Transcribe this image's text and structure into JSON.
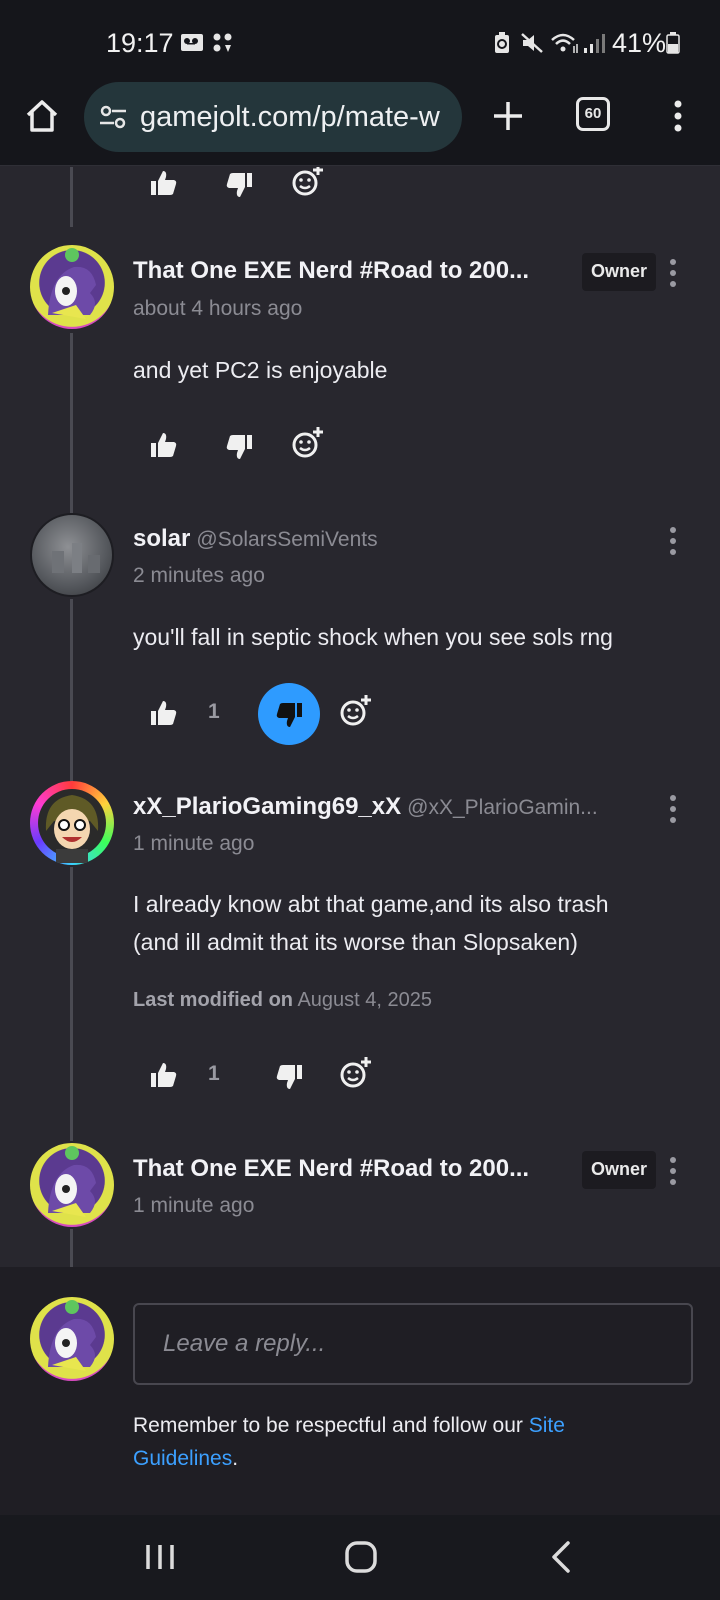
{
  "status_bar": {
    "time": "19:17",
    "battery_pct": "41%",
    "icons": [
      "voicemail-icon",
      "dots-icon",
      "battery-saver-icon",
      "mute-icon",
      "wifi-icon",
      "signal-icon",
      "battery-icon"
    ]
  },
  "browser": {
    "url": "gamejolt.com/p/mate-w",
    "tab_count": "60",
    "icons": [
      "home-icon",
      "site-settings-icon",
      "new-tab-icon",
      "tabs-icon",
      "menu-icon"
    ]
  },
  "comments": [
    {
      "author": "That One EXE Nerd #Road to 200...",
      "badge": "Owner",
      "time": "about 4 hours ago",
      "text": "and yet PC2 is enjoyable"
    },
    {
      "author": "solar",
      "handle": "@SolarsSemiVents",
      "time": "2 minutes ago",
      "text": "you'll fall in septic shock when you see sols rng",
      "likes": "1"
    },
    {
      "author": "xX_PlarioGaming69_xX",
      "handle": "@xX_PlarioGamin...",
      "time": "1 minute ago",
      "text_line1": "I already know abt that game,and its also trash",
      "text_line2": "(and ill admit that its worse than Slopsaken)",
      "modified_label": "Last modified on",
      "modified_date": "August 4, 2025",
      "likes": "1"
    },
    {
      "author": "That One EXE Nerd #Road to 200...",
      "badge": "Owner",
      "time": "1 minute ago"
    }
  ],
  "reply": {
    "placeholder": "Leave a reply...",
    "notice_prefix": "Remember to be respectful and follow our ",
    "link_line1": "Site",
    "link_line2": "Guidelines",
    "notice_suffix": "."
  },
  "colors": {
    "background": "#28272e",
    "accent": "#2e9bff",
    "link": "#3ca0ff"
  }
}
